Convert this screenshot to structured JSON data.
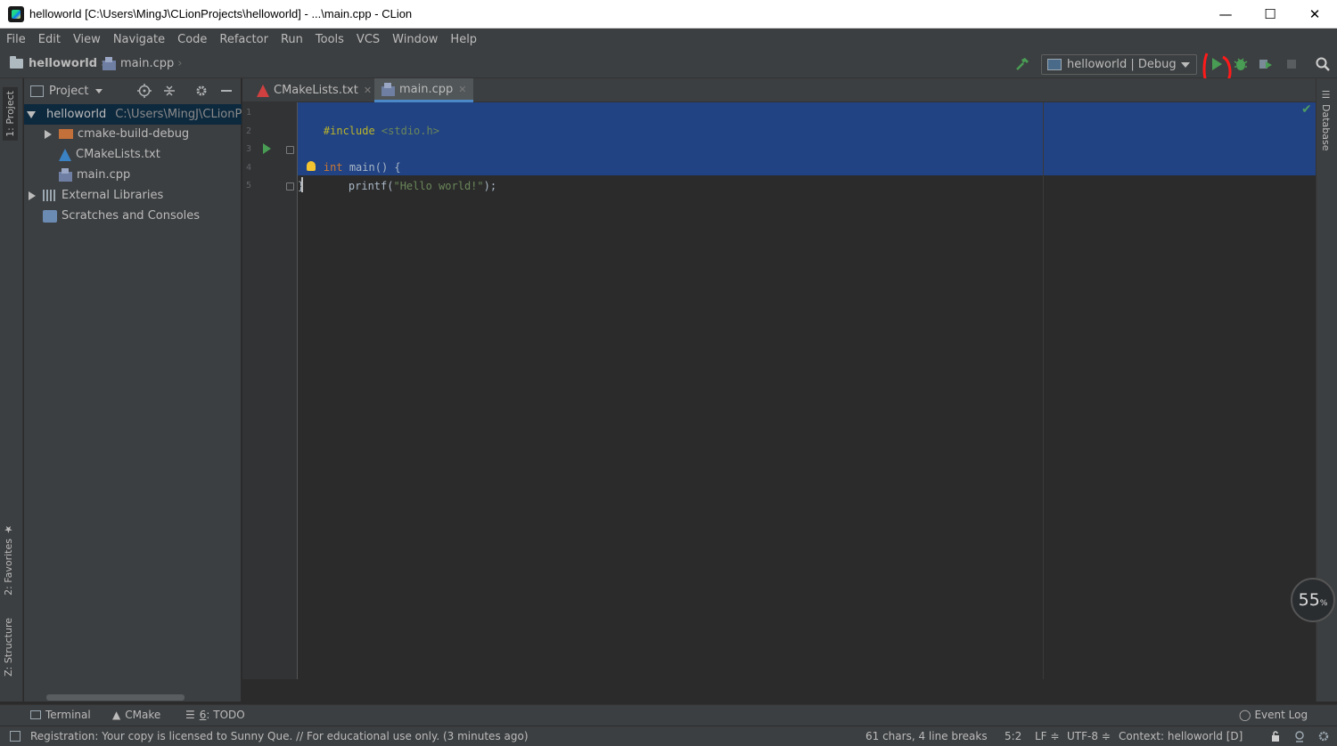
{
  "window": {
    "title": "helloworld [C:\\Users\\MingJ\\CLionProjects\\helloworld] - ...\\main.cpp - CLion",
    "minimize": "—",
    "maximize": "☐",
    "close": "✕"
  },
  "menu": [
    "File",
    "Edit",
    "View",
    "Navigate",
    "Code",
    "Refactor",
    "Run",
    "Tools",
    "VCS",
    "Window",
    "Help"
  ],
  "breadcrumb": {
    "project": "helloworld",
    "file": "main.cpp"
  },
  "toolbar": {
    "run_config": "helloworld | Debug",
    "icons": [
      "hammer-icon",
      "run-icon",
      "debug-icon",
      "run-with-coverage-icon",
      "stop-icon",
      "search-icon"
    ]
  },
  "left_tabs": {
    "project": "1: Project",
    "favorites": "2: Favorites",
    "structure": "Z: Structure"
  },
  "project_panel": {
    "title": "Project",
    "tree": [
      {
        "label": "helloworld",
        "path": "C:\\Users\\MingJ\\CLionProjects\\helloworld"
      },
      {
        "label": "cmake-build-debug"
      },
      {
        "label": "CMakeLists.txt"
      },
      {
        "label": "main.cpp"
      },
      {
        "label": "External Libraries"
      },
      {
        "label": "Scratches and Consoles"
      }
    ]
  },
  "editor_tabs": [
    {
      "label": "CMakeLists.txt"
    },
    {
      "label": "main.cpp",
      "active": true
    }
  ],
  "editor": {
    "line_numbers": [
      "1",
      "2",
      "3",
      "4",
      "5"
    ],
    "code": {
      "l1_directive": "#include",
      "l1_header": " <stdio.h>",
      "l3_kw": "int",
      "l3_rest": " main() {",
      "l4_fn": "printf(",
      "l4_str": "\"Hello world!\"",
      "l4_end": ");",
      "l5": "}"
    }
  },
  "right_tabs": {
    "database": "Database"
  },
  "memory_indicator": {
    "value": "55",
    "unit": "%"
  },
  "toolwindows": {
    "terminal": "Terminal",
    "cmake": "CMake",
    "todo_num": "6",
    "todo": ": TODO",
    "event_log": "Event Log"
  },
  "status": {
    "message": "Registration: Your copy is licensed to Sunny Que. // For educational use only. (3 minutes ago)",
    "chars": "61 chars, 4 line breaks",
    "position": "5:2",
    "line_sep": "LF ≑",
    "encoding": "UTF-8 ≑",
    "context": "Context: helloworld [D]"
  }
}
